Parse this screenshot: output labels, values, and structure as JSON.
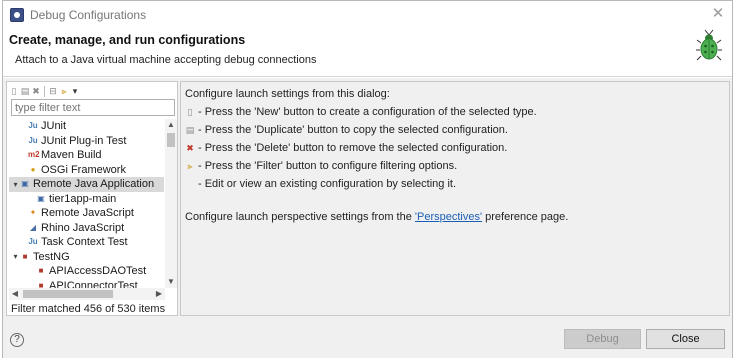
{
  "window": {
    "title": "Debug Configurations"
  },
  "header": {
    "title": "Create, manage, and run configurations",
    "description": "Attach to a Java virtual machine accepting debug connections"
  },
  "left_panel": {
    "filter_placeholder": "type filter text",
    "filter_value": "",
    "status": "Filter matched 456 of 530 items",
    "toolbar": [
      {
        "name": "new-config-icon"
      },
      {
        "name": "duplicate-config-icon"
      },
      {
        "name": "delete-config-icon"
      },
      {
        "name": "collapse-all-icon"
      },
      {
        "name": "filter-icon"
      },
      {
        "name": "view-menu-icon"
      }
    ],
    "tree": [
      {
        "label": "JUnit",
        "indent": 1,
        "icon": "junit-icon",
        "icon_glyph": "Ju",
        "icon_color": "#4a7fb5",
        "twisty": "",
        "selected": false
      },
      {
        "label": "JUnit Plug-in Test",
        "indent": 1,
        "icon": "junit-plugin-icon",
        "icon_glyph": "Ju",
        "icon_color": "#4a7fb5",
        "twisty": "",
        "selected": false
      },
      {
        "label": "Maven Build",
        "indent": 1,
        "icon": "maven-icon",
        "icon_glyph": "m2",
        "icon_color": "#c0392b",
        "twisty": "",
        "selected": false
      },
      {
        "label": "OSGi Framework",
        "indent": 1,
        "icon": "osgi-icon",
        "icon_glyph": "●",
        "icon_color": "#d4a017",
        "twisty": "",
        "selected": false
      },
      {
        "label": "Remote Java Application",
        "indent": 0,
        "icon": "remote-java-icon",
        "icon_glyph": "▣",
        "icon_color": "#3c6aa8",
        "twisty": "▾",
        "selected": true
      },
      {
        "label": "tier1app-main",
        "indent": 2,
        "icon": "remote-config-icon",
        "icon_glyph": "▣",
        "icon_color": "#3c6aa8",
        "twisty": "",
        "selected": false
      },
      {
        "label": "Remote JavaScript",
        "indent": 1,
        "icon": "remote-js-icon",
        "icon_glyph": "✦",
        "icon_color": "#d88a1a",
        "twisty": "",
        "selected": false
      },
      {
        "label": "Rhino JavaScript",
        "indent": 1,
        "icon": "rhino-icon",
        "icon_glyph": "◢",
        "icon_color": "#4a6fa5",
        "twisty": "",
        "selected": false
      },
      {
        "label": "Task Context Test",
        "indent": 1,
        "icon": "task-context-icon",
        "icon_glyph": "Ju",
        "icon_color": "#4a7fb5",
        "twisty": "",
        "selected": false
      },
      {
        "label": "TestNG",
        "indent": 0,
        "icon": "testng-icon",
        "icon_glyph": "■",
        "icon_color": "#b03a2e",
        "twisty": "▾",
        "selected": false
      },
      {
        "label": "APIAccessDAOTest",
        "indent": 2,
        "icon": "testng-test-icon",
        "icon_glyph": "■",
        "icon_color": "#b03a2e",
        "twisty": "",
        "selected": false
      },
      {
        "label": "APIConnectorTest",
        "indent": 2,
        "icon": "testng-test-icon",
        "icon_glyph": "■",
        "icon_color": "#b03a2e",
        "twisty": "",
        "selected": false
      }
    ]
  },
  "right_panel": {
    "heading": "Configure launch settings from this dialog:",
    "lines": [
      {
        "icon": "new-config-icon",
        "glyph": "▯",
        "color": "#8a8a8a",
        "text": "- Press the 'New' button to create a configuration of the selected type."
      },
      {
        "icon": "duplicate-config-icon",
        "glyph": "▤",
        "color": "#8a8a8a",
        "text": "- Press the 'Duplicate' button to copy the selected configuration."
      },
      {
        "icon": "delete-config-icon",
        "glyph": "✖",
        "color": "#c0392b",
        "text": "- Press the 'Delete' button to remove the selected configuration."
      },
      {
        "icon": "filter-icon",
        "glyph": "⫸",
        "color": "#c99a1a",
        "text": "- Press the 'Filter' button to configure filtering options."
      },
      {
        "icon": "",
        "glyph": "",
        "color": "#222222",
        "text": "- Edit or view an existing configuration by selecting it."
      }
    ],
    "perspective_prefix": "Configure launch perspective settings from the ",
    "perspective_link": "'Perspectives'",
    "perspective_suffix": " preference page."
  },
  "footer": {
    "help_label": "?",
    "debug_label": "Debug",
    "close_label": "Close"
  },
  "colors": {
    "link": "#1a5fb4",
    "selected_row": "#d9d9d9",
    "disabled_button": "#cccccc"
  }
}
